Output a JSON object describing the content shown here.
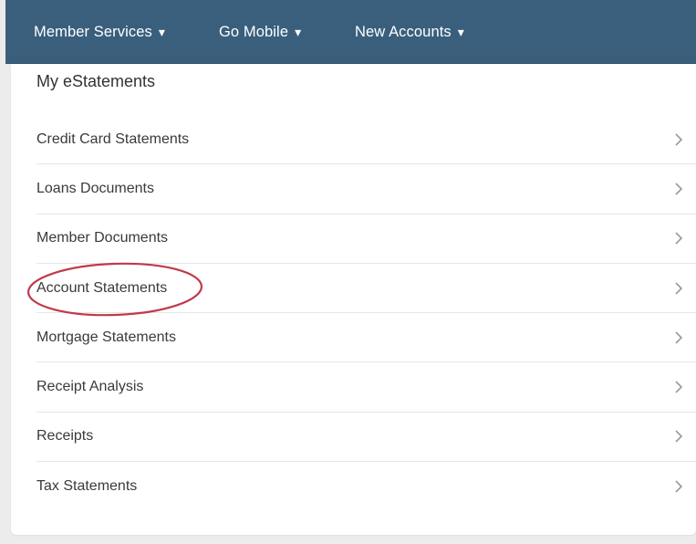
{
  "nav": {
    "items": [
      {
        "label": "Member Services",
        "caret": "▾"
      },
      {
        "label": "Go Mobile",
        "caret": "▾"
      },
      {
        "label": "New Accounts",
        "caret": "▾"
      }
    ]
  },
  "panel": {
    "title": "My eStatements",
    "items": [
      {
        "label": "Credit Card Statements"
      },
      {
        "label": "Loans Documents"
      },
      {
        "label": "Member Documents"
      },
      {
        "label": "Account Statements",
        "highlighted": true
      },
      {
        "label": "Mortgage Statements"
      },
      {
        "label": "Receipt Analysis"
      },
      {
        "label": "Receipts"
      },
      {
        "label": "Tax Statements"
      }
    ]
  },
  "colors": {
    "navbar": "#3a5f7d",
    "highlight": "#c0394b",
    "chevron": "#9a9a9a"
  },
  "icons": {
    "item_arrow": "chevron-right-icon",
    "nav_caret": "caret-down-icon"
  }
}
